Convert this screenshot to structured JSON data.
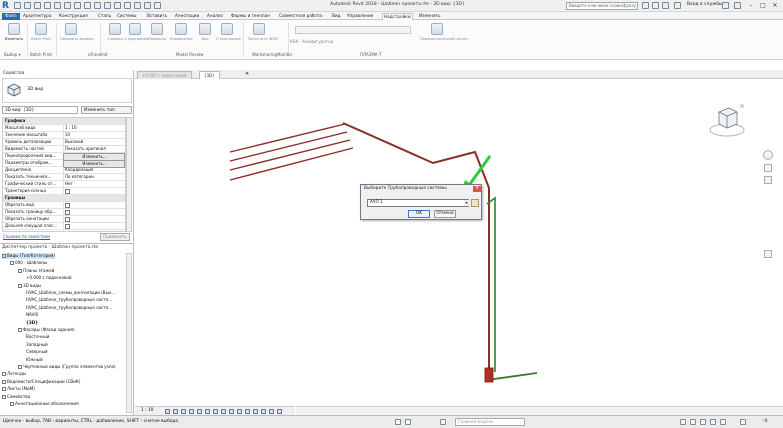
{
  "title_bar": {
    "app_logo": "R",
    "window_title": "Autodesk Revit 2018 - Шаблон проекта.rte - 3D вид: {3D}",
    "search_placeholder": "Введите ключевое слово/фразу",
    "signin_label": "Вход в службы",
    "minimize": "–",
    "maximize": "□",
    "close": "✕"
  },
  "ribbon_tabs": [
    "Файл",
    "Архитектура",
    "Конструкция",
    "Сталь",
    "Системы",
    "Вставить",
    "Аннотации",
    "Анализ",
    "Формы и генплан",
    "Совместная работа",
    "Вид",
    "Управление",
    "Надстройки",
    "Изменить"
  ],
  "active_tab": "Надстройки",
  "ribbon": {
    "buttons": [
      "Изменить",
      "Batch Print",
      "Передать модели",
      "Справка",
      "О программе",
      "Проверка",
      "Управление",
      "Вид",
      "О программе",
      "Запустить WSM",
      "Параметрический расчет"
    ],
    "panels": [
      "Выбор ▾",
      "Batch Print",
      "eTransmit",
      "Model Review",
      "WorksharingMonitor",
      "ПЛАЗМА-Т"
    ],
    "config_text": "КВК - Конфигуратор"
  },
  "properties": {
    "title": "Свойства",
    "type_name": "3D вид",
    "instance": "3D вид: {3D}",
    "edit_type": "Изменить тип",
    "rows": [
      {
        "group": "Графика"
      },
      {
        "k": "Масштаб вида",
        "v": "1 : 10"
      },
      {
        "k": "Значение масштаба",
        "v": "10"
      },
      {
        "k": "Уровень детализации",
        "v": "Высокий"
      },
      {
        "k": "Видимость частей",
        "v": "Показать оригинал"
      },
      {
        "k": "Переопределения вид...",
        "v": "Изменить...",
        "btn": true
      },
      {
        "k": "Параметры отображ...",
        "v": "Изменить...",
        "btn": true
      },
      {
        "k": "Дисциплина",
        "v": "Координация"
      },
      {
        "k": "Показать техническ...",
        "v": "По категории"
      },
      {
        "k": "Графический стиль от...",
        "v": "Нет"
      },
      {
        "k": "Траектория солнца",
        "v": "",
        "cb": true
      },
      {
        "group": "Границы"
      },
      {
        "k": "Обрезать вид",
        "v": "",
        "cb": true
      },
      {
        "k": "Показать границу обр...",
        "v": "",
        "cb": true
      },
      {
        "k": "Обрезать аннотации",
        "v": "",
        "cb": true
      },
      {
        "k": "Дальняя секущая плос...",
        "v": "",
        "cb": true
      }
    ],
    "help_link": "Справка по свойствам",
    "apply": "Применить"
  },
  "browser": {
    "title": "Диспетчер проекта - Шаблон проекта.rte",
    "nodes": [
      {
        "t": "Виды (Тип/Категория)",
        "d": 0,
        "sel": true,
        "exp": true
      },
      {
        "t": "000 - Шаблоны",
        "d": 1,
        "exp": true
      },
      {
        "t": "Планы этажей",
        "d": 2,
        "exp": true
      },
      {
        "t": "+0.000 с подосновой",
        "d": 3
      },
      {
        "t": "3D виды",
        "d": 2,
        "exp": true
      },
      {
        "t": "HVAC_Шаблон_схемы_вентиляции (Вых...",
        "d": 3
      },
      {
        "t": "HVAC_Шаблон_трубопроводные систе...",
        "d": 3
      },
      {
        "t": "HVAC_Шаблон_трубопроводные систе...",
        "d": 3
      },
      {
        "t": "NAVIS",
        "d": 3
      },
      {
        "t": "{3D}",
        "d": 3,
        "bold": true
      },
      {
        "t": "Фасады (Фасад здания)",
        "d": 2,
        "exp": true
      },
      {
        "t": "Восточный",
        "d": 3
      },
      {
        "t": "Западный",
        "d": 3
      },
      {
        "t": "Северный",
        "d": 3
      },
      {
        "t": "Южный",
        "d": 3
      },
      {
        "t": "Чертежные виды (Группа элементов узла)",
        "d": 2,
        "exp": true
      },
      {
        "t": "Легенды",
        "d": 0,
        "exp": true
      },
      {
        "t": "Ведомости/Спецификации (СВиК)",
        "d": 0,
        "exp": true
      },
      {
        "t": "Листы (МиМ)",
        "d": 0,
        "exp": true
      },
      {
        "t": "Семейства",
        "d": 0,
        "exp": true
      },
      {
        "t": "Аннотационные обозначения",
        "d": 1,
        "exp": true
      }
    ]
  },
  "view_tabs": [
    {
      "label": "+0.000 с подосновой",
      "active": false
    },
    {
      "label": "{3D}",
      "active": true
    },
    {
      "label": "✕",
      "active": false
    }
  ],
  "dialog": {
    "title": "Выберите Трубопроводные системы",
    "close": "✕",
    "selected": "АУП 1",
    "ok": "OK",
    "cancel": "Отмена"
  },
  "view_control": {
    "scale": "1 : 10"
  },
  "status": {
    "text": "Щелчок - выбор, TAB - варианты, CTRL - добавление, SHIFT - снятие выбора.",
    "model": "Главная модель",
    "filter": "∵0"
  },
  "colors": {
    "pipe_red": "#8b2e24",
    "pipe_green": "#3a7a2e",
    "arrow_green": "#2ecc40",
    "accent": "#2b6cb0"
  }
}
